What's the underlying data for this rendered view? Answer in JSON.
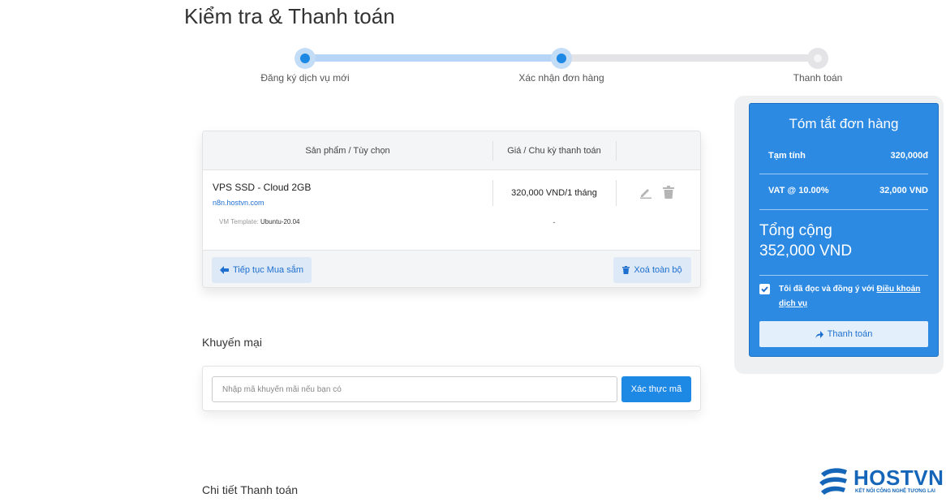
{
  "page": {
    "title": "Kiểm tra & Thanh toán"
  },
  "stepper": {
    "steps": [
      {
        "label": "Đăng ký dịch vụ mới",
        "state": "done"
      },
      {
        "label": "Xác nhận đơn hàng",
        "state": "active"
      },
      {
        "label": "Thanh toán",
        "state": "pending"
      }
    ]
  },
  "cart": {
    "headers": {
      "product": "Sản phẩm / Tùy chọn",
      "price": "Giá / Chu kỳ thanh toán"
    },
    "items": [
      {
        "name": "VPS SSD - Cloud 2GB",
        "domain": "n8n.hostvn.com",
        "option_label": "VM Template:",
        "option_value": "Ubuntu-20.04",
        "price": "320,000 VND/1 tháng",
        "option_price": "-"
      }
    ],
    "continue_label": "Tiếp tục Mua sắm",
    "clear_label": "Xoá toàn bộ"
  },
  "promo": {
    "title": "Khuyến mại",
    "placeholder": "Nhập mã khuyến mãi nếu bạn có",
    "button": "Xác thực mã"
  },
  "payment_details": {
    "title": "Chi tiết Thanh toán"
  },
  "summary": {
    "title": "Tóm tắt đơn hàng",
    "subtotal_label": "Tạm tính",
    "subtotal_value": "320,000đ",
    "vat_label": "VAT @ 10.00%",
    "vat_value": "32,000 VND",
    "total_label": "Tổng cộng",
    "total_value": "352,000 VND",
    "agree_text": "Tôi đã đọc và đồng ý với ",
    "agree_link": "Điều khoản dịch vụ",
    "agree_checked": true,
    "checkout_label": "Thanh toán"
  },
  "logo": {
    "name": "HOSTVN",
    "tagline": "KẾT NỐI CÔNG NGHỆ TƯƠNG LAI"
  },
  "colors": {
    "accent": "#1e88e5",
    "summary_bg": "#2d8ae2",
    "soft_button": "#dde9f7"
  },
  "icons": [
    "edit-icon",
    "trash-icon",
    "arrow-left-icon",
    "arrow-right-icon",
    "check-icon"
  ]
}
